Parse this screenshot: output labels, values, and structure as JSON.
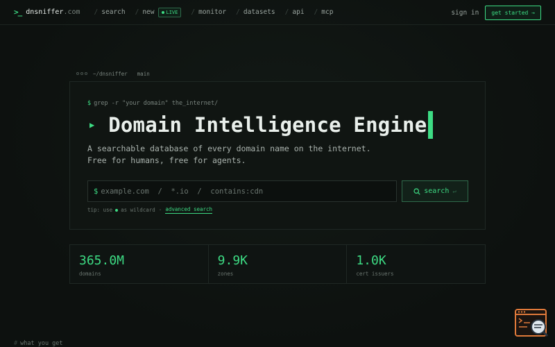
{
  "nav": {
    "brand_prompt": ">_",
    "brand_name": "dnsniffer",
    "brand_tld": ".com",
    "links": [
      {
        "label": "search"
      },
      {
        "label": "new",
        "badge": "LIVE"
      },
      {
        "label": "monitor"
      },
      {
        "label": "datasets"
      },
      {
        "label": "api"
      },
      {
        "label": "mcp"
      }
    ],
    "signin": "sign in",
    "get_started": "get started →"
  },
  "terminal": {
    "path": "~/dnsniffer",
    "branch": "main",
    "command": "grep -r \"your domain\" the_internet/",
    "play_icon": "▶",
    "title": "Domain Intelligence Engine",
    "desc_line1": "A searchable database of every domain name on the internet.",
    "desc_line2": "Free for humans, free for agents.",
    "search_prefix": "$",
    "search_placeholder": "example.com  /  *.io  /  contains:cdn",
    "search_button": "search",
    "search_enter": "↵",
    "tip_prefix": "tip: use",
    "tip_suffix": "as wildcard",
    "tip_sep": "·",
    "advanced_search": "advanced search"
  },
  "stats": [
    {
      "value": "365.0M",
      "label": "domains"
    },
    {
      "value": "9.9K",
      "label": "zones"
    },
    {
      "value": "1.0K",
      "label": "cert issuers"
    }
  ],
  "footer": {
    "hash": "#",
    "section_label": "what you get"
  },
  "colors": {
    "accent": "#3ddc84",
    "background": "#0e1210",
    "floater": "#e07a3a"
  },
  "icons": {
    "brand": "terminal-prompt-icon",
    "live": "live-dot-icon",
    "search": "magnifier-icon",
    "floater": "code-window-magnifier-icon"
  }
}
